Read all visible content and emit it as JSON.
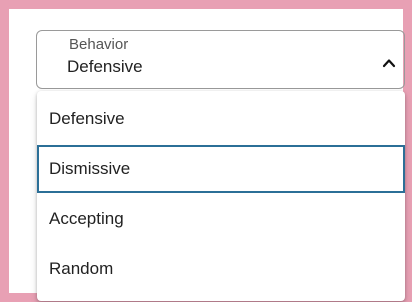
{
  "select": {
    "label": "Behavior",
    "value": "Defensive",
    "toggle_icon": "chevron-up-icon"
  },
  "menu": {
    "options": [
      {
        "label": "Defensive"
      },
      {
        "label": "Dismissive",
        "focused": true
      },
      {
        "label": "Accepting"
      },
      {
        "label": "Random"
      }
    ]
  },
  "colors": {
    "frame_border": "#e8a0b4",
    "focus_border": "#2b6f97"
  }
}
